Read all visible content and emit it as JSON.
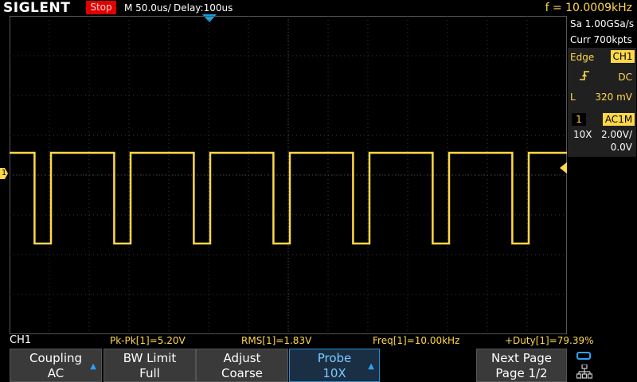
{
  "header": {
    "brand": "SIGLENT",
    "run_state": "Stop",
    "timebase": "M 50.0us/",
    "delay": "Delay:100us",
    "trigger_frequency": "f = 10.0009kHz"
  },
  "acquisition": {
    "sample_rate": "Sa 1.00GSa/s",
    "memory_depth": "Curr 700kpts"
  },
  "trigger": {
    "type": "Edge",
    "source": "CH1",
    "slope_icon": "rising-edge-icon",
    "coupling": "DC",
    "level_label": "L",
    "level": "320 mV"
  },
  "channel": {
    "number": "1",
    "coupling": "AC1M",
    "probe": "10X",
    "scale": "2.00V/",
    "offset": "0.0V",
    "marker": "1",
    "color": "#ffd84a"
  },
  "measurements": {
    "channel": "CH1",
    "pkpk": "Pk-Pk[1]=5.20V",
    "rms": "RMS[1]=1.83V",
    "freq": "Freq[1]=10.00kHz",
    "duty": "+Duty[1]=79.39%"
  },
  "menu": {
    "coupling": {
      "label": "Coupling",
      "value": "AC"
    },
    "bw_limit": {
      "label": "BW Limit",
      "value": "Full"
    },
    "adjust": {
      "label": "Adjust",
      "value": "Coarse"
    },
    "probe": {
      "label": "Probe",
      "value": "10X"
    },
    "next_page": {
      "label": "Next Page",
      "value": "Page 1/2"
    }
  },
  "colors": {
    "trace": "#ffd84a",
    "accent": "#2aa2ff",
    "stop": "#e00000"
  },
  "waveform": {
    "frequency_hz": 10000,
    "duty_percent": 79.39,
    "high_div": 0.55,
    "low_div": -2.1
  }
}
